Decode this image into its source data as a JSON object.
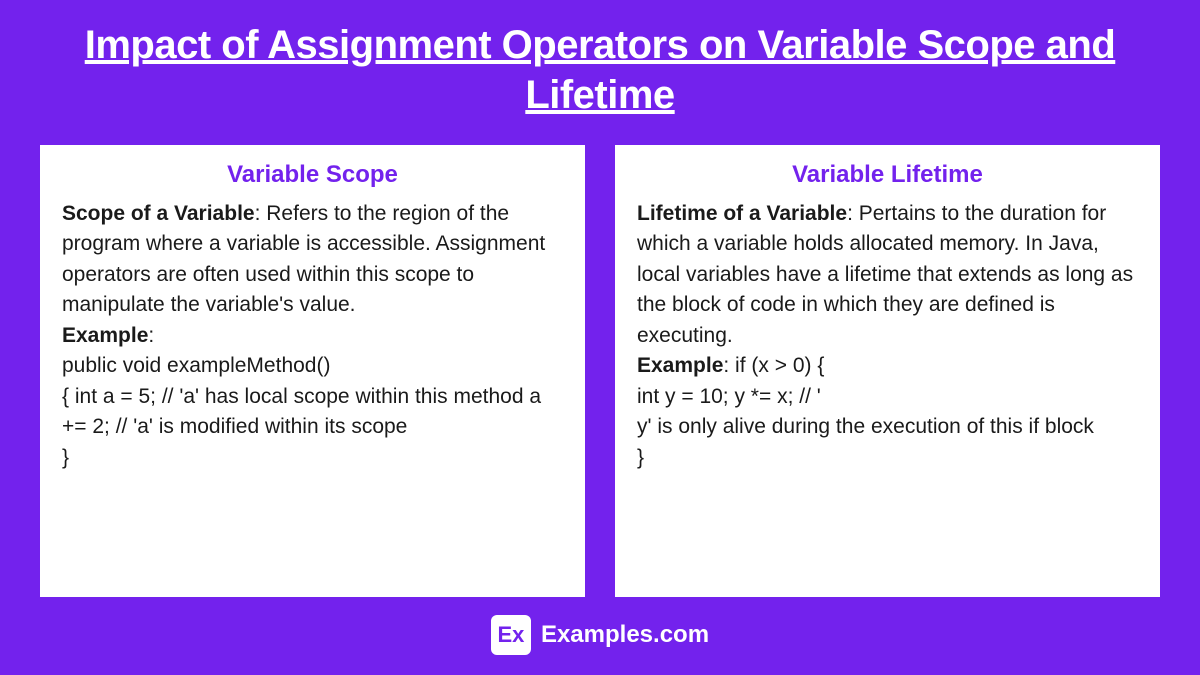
{
  "title": "Impact of Assignment Operators on Variable Scope and Lifetime",
  "cards": [
    {
      "heading": "Variable Scope",
      "defLabel": "Scope of a Variable",
      "defText": ": Refers to the region of the program where a variable is accessible. Assignment operators are often used within this scope to manipulate the variable's value.",
      "exampleLabel": "Example",
      "exampleIntro": ":",
      "codeLines": [
        "public void exampleMethod()",
        "{ int a = 5; // 'a' has local scope within this method a += 2; // 'a' is modified within its scope",
        " }"
      ]
    },
    {
      "heading": "Variable Lifetime",
      "defLabel": "Lifetime of a Variable",
      "defText": ": Pertains to the duration for which a variable holds allocated memory. In Java, local variables have a lifetime that extends as long as the block of code in which they are defined is executing.",
      "exampleLabel": "Example",
      "exampleIntro": ":  if (x > 0) {",
      "codeLines": [
        "int y = 10; y *= x; // '",
        "y' is only alive during the execution of this if block",
        " }"
      ]
    }
  ],
  "footer": {
    "logo": "Ex",
    "text": "Examples.com"
  }
}
